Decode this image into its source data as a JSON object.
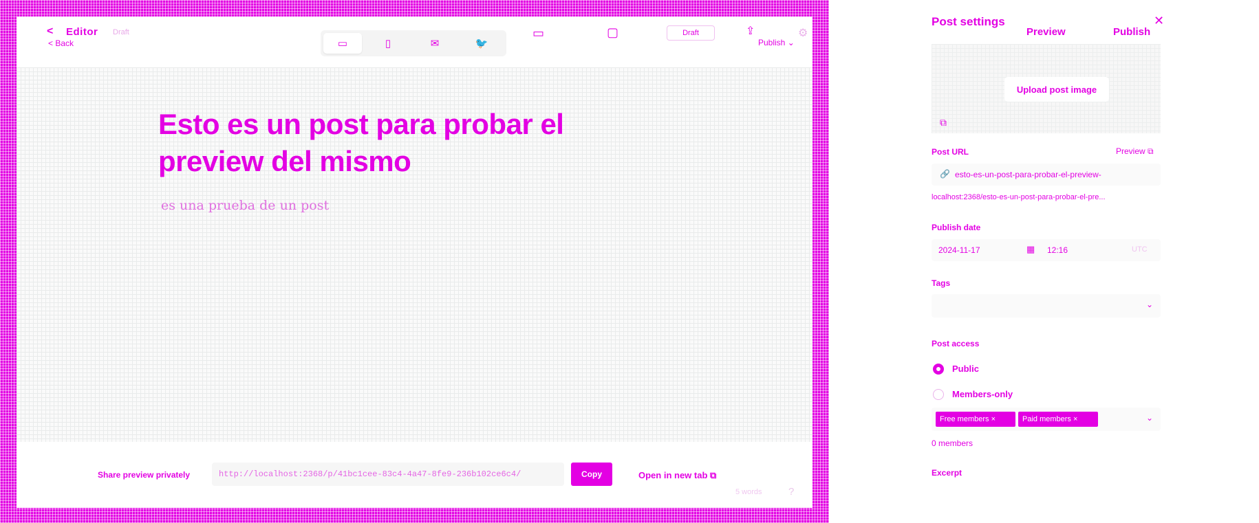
{
  "editor": {
    "back_chevron": "<",
    "title": "Editor",
    "subtitle": "Draft",
    "back_label": "< Back",
    "devices": {
      "desktop_icon": "▭",
      "mobile_icon": "▯",
      "email_icon": "✉",
      "social_icon": "🐦"
    },
    "monitor_icon": "▭",
    "tablet_icon": "▢",
    "status_chip": "Draft",
    "share_icon": "⇪",
    "publish_label": "Publish ⌄",
    "settings_icon": "⚙"
  },
  "post": {
    "title": "Esto es un post para probar el preview del mismo",
    "excerpt": "es una prueba de un post"
  },
  "share": {
    "label": "Share preview privately",
    "url": "http://localhost:2368/p/41bc1cee-83c4-4a47-8fe9-236b102ce6c4/",
    "copy_label": "Copy",
    "open_new_tab": "Open in new tab ⧉",
    "word_count": "5 words",
    "help_icon": "?"
  },
  "settings": {
    "title": "Post settings",
    "close_icon": "✕",
    "preview_label": "Preview",
    "publish_label": "Publish",
    "upload_image": "Upload post image",
    "image_icon": "⧉",
    "url_label": "Post URL",
    "url_preview": "Preview ⧉",
    "url_lock_icon": "🔗",
    "url_slug": "esto-es-un-post-para-probar-el-preview-",
    "url_full": "localhost:2368/esto-es-un-post-para-probar-el-pre...",
    "date_label": "Publish date",
    "date_value": "2024-11-17",
    "calendar_icon": "▦",
    "time_value": "12:16",
    "time_zone": "UTC",
    "tags_label": "Tags",
    "tags_chevron": "⌄",
    "access_label": "Post access",
    "public_label": "Public",
    "members_label": "Members-only",
    "tiers": [
      "Free members ×",
      "Paid members ×"
    ],
    "tiers_chevron": "⌄",
    "member_count": "0 members",
    "excerpt_label": "Excerpt"
  },
  "colors": {
    "accent": "#e300e3",
    "canvas": "#fafafa"
  }
}
